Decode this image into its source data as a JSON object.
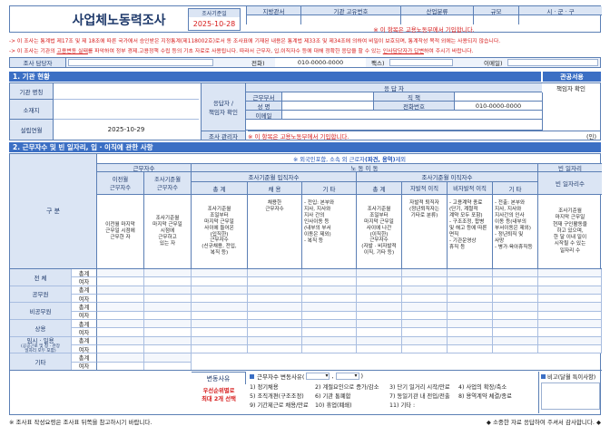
{
  "header": {
    "title": "사업체노동력조사",
    "survey_date_label": "조사기준일",
    "survey_date": "2025-10-28",
    "columns": [
      "지방관서",
      "기관 고유번호",
      "산업분류",
      "규모",
      "시 · 군 · 구"
    ],
    "notice_red": "※ 이 항목은 고용노동부에서 기입합니다."
  },
  "notices": {
    "line1": "-> 이 조사는 통계법 제17조 및 제 18조에 따른 국가에서 승인받은 지정통계(제118002호)로서 동 조사표에 기재된 내용은 통계법 제33조 및 제34조에 의하여 비밀이 보호되며, 통계작성 목적 외에는 사용되지 않습니다.",
    "line2_prefix": "-> 이 조사는 기관의 ",
    "line2_highlight": "고용변동 실태",
    "line2_suffix": "를 파악하여 정부 경제.고용정책 수립 등의 기초 자료로 사용됩니다. 따라서 근무자, 입.이직자수 등에 대해 정확한 응답을 할 수 있는 ",
    "line2_highlight2": "인사담당자가 답변",
    "line2_end": "하여 주시기 바랍니다."
  },
  "contact": {
    "manager_label": "조사 담당자",
    "phone_label": "전화)",
    "phone_value": "010-0000-0000",
    "fax_label": "팩스)",
    "email_label": "이메일)"
  },
  "section1": {
    "title": "1. 기관 현황",
    "button": "관공서용",
    "rows": {
      "name_label": "기관 명칭",
      "address_label": "소재지",
      "established_label": "설립연월",
      "established_value": "2025-10-29",
      "respondent_label": "응답자 /\n책임자 확인",
      "respondent_header": "응 답 자",
      "responsible_header": "책임자 확인",
      "dept_label": "근무부서",
      "position_label": "직  책",
      "name2_label": "성  명",
      "tel_label": "전화번호",
      "tel_value": "010-0000-0000",
      "email_label": "이메일",
      "admin_label": "조사 관리자",
      "admin_note": "※ 이 항목은 고용노동부에서 기입합니다.",
      "seal": "(인)"
    }
  },
  "section2": {
    "title": "2. 근무자수 및 빈 일자리, 입 · 이직에 관한 사항",
    "note_prefix": "※ 외국인포함, 소속 외 근로자",
    "note_bold": "(파견, 용역)",
    "note_suffix": " 제외",
    "groups": {
      "workers": "근무자수",
      "labor_move": "노 동 이 동",
      "vacancy": "빈 일자리"
    },
    "sub": {
      "prev_month": "이전월\n근무자수",
      "this_month": "조사기준월\n근무자수",
      "entries": "조사기준월 입직자수",
      "exits": "조사기준월 이직자수",
      "vacancy_count": "빈 일자리수"
    },
    "sub2": {
      "total1": "총  계",
      "hiring": "채  용",
      "other1": "기  타",
      "total2": "총  계",
      "voluntary": "자발적 이직",
      "involuntary": "비자발적 이직",
      "other2": "기  타"
    },
    "desc": {
      "prev": "이전월 마지막\n근무일 시점에\n근무한 자",
      "cur": "조사기준월\n마지막 근무일\n시점에\n근무하고\n있는 자",
      "total1": "조사기준월\n조일부터\n마지막 근무일\n사이에 들어온\n(입직한)\n근무자수\n(신규채용, 전입,\n복직 등)",
      "hiring": "채용한\n근무자수",
      "other1": "- 전입: 본부와\n지사, 지사와\n지사 간의\n인사이동 등\n(내부의 부서\n이동은 제외)\n- 복직 등",
      "total2": "조사기준월\n조일부터\n마지막 근무일\n사이에 나간\n(이직한)\n근무자수\n(자발 · 비자발적\n이직, 기타 등)",
      "voluntary": "자발적 퇴직자\n(정년퇴직자는\n기타로 분류)",
      "involuntary": "- 고용계약 종료\n(단기, 계절적\n계약 모두 포함)\n- 구조조정, 합병\n및 해고 등에 따른\n면직\n- 기관운영상\n휴직 등",
      "other2": "- 전출: 본부와\n지사, 지사와\n지사간의 인사\n이동 등(내부의\n부서이동은 제외)\n- 정년퇴직 및\n사망\n- 병가·육아휴직등",
      "vacancy": "조사기준월\n마지막 근무일\n현재 구인활동을\n하고 있으며,\n한 달 이내 일이\n시작될 수 있는\n일자리 수",
      "vacancy_hl": "한 달 이내"
    },
    "row_header": "구 분",
    "rows": [
      {
        "label": "전 체",
        "sub": [
          "총계",
          "여자"
        ]
      },
      {
        "label": "공무원",
        "sub": [
          "총계",
          "여자"
        ]
      },
      {
        "label": "비공무원",
        "sub": [
          "총계",
          "여자"
        ]
      },
      {
        "label": "상용",
        "sub": [
          "총계",
          "여자"
        ]
      },
      {
        "label": "임시 · 일용",
        "sublabel": "(공공근로 및 청 · 관장\n일자리 모두 포함)",
        "sub": [
          "총계",
          "여자"
        ]
      },
      {
        "label": "기타",
        "sub": [
          "총계",
          "여자"
        ]
      }
    ],
    "change": {
      "label": "변동사유",
      "hint": "우선순위별로\n최대 2개 선택",
      "box_title": "근무자수 변동사유(",
      "box_title_end": ")",
      "options": [
        "1) 정기채용",
        "2) 계절요인으로 증가/감소",
        "3) 단기 일거리 시작/만료",
        "4) 사업의 확장/축소",
        "5) 조직개편(구조조정)",
        "6) 기관 통폐합",
        "7) 동일기관 내 전입/전출",
        "8) 용역계약 체결/종료",
        "9) 기간제근로 채용/만료",
        "10) 휴업(폐쇄)",
        "11) 기타 :"
      ],
      "remark": "비고(달월 특이사항)"
    }
  },
  "footer": {
    "left": "※ 조사표 작성요령은 조사표 뒤쪽을 참고하시기 바랍니다.",
    "right": "◆ 소중한 자료 응답하여 주셔서 감사합니다. ◆"
  },
  "colors": {
    "accent": "#3b6fc4",
    "header_bg": "#dbe5f4",
    "red": "#d61a1a"
  }
}
